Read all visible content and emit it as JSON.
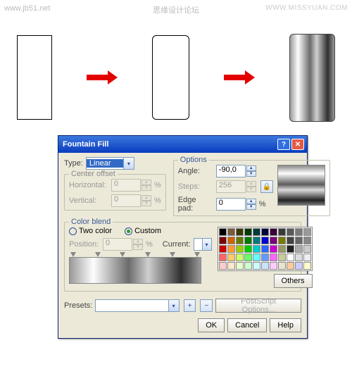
{
  "watermarks": {
    "left": "www.jb51.net",
    "center": "思缘设计论坛",
    "right": "WWW.MISSYUAN.COM"
  },
  "dialog": {
    "title": "Fountain Fill",
    "type_label": "Type:",
    "type_value": "Linear",
    "center_offset": {
      "title": "Center offset",
      "horiz_label": "Horizontal:",
      "horiz_val": "0",
      "horiz_unit": "%",
      "vert_label": "Vertical:",
      "vert_val": "0",
      "vert_unit": "%"
    },
    "options": {
      "title": "Options",
      "angle_label": "Angle:",
      "angle_val": "-90,0",
      "steps_label": "Steps:",
      "steps_val": "256",
      "edge_label": "Edge pad:",
      "edge_val": "0",
      "edge_unit": "%"
    },
    "color_blend": {
      "title": "Color blend",
      "two_color": "Two color",
      "custom": "Custom",
      "position_label": "Position:",
      "position_val": "0",
      "position_unit": "%",
      "current_label": "Current:",
      "others": "Others"
    },
    "presets_label": "Presets:",
    "postscript": "PostScript Options...",
    "ok": "OK",
    "cancel": "Cancel",
    "help": "Help"
  },
  "palette": [
    "#000000",
    "#7a5c3a",
    "#3a3a00",
    "#003a00",
    "#003a3a",
    "#00003a",
    "#3a003a",
    "#3a3a3a",
    "#5a5a5a",
    "#7a7a7a",
    "#9a9a9a",
    "#7a0000",
    "#cc6600",
    "#667a00",
    "#007a00",
    "#007a7a",
    "#0000cc",
    "#7a007a",
    "#7a7a00",
    "#444444",
    "#666666",
    "#888888",
    "#cc0000",
    "#ff9933",
    "#99cc00",
    "#00cc00",
    "#00cccc",
    "#3366ff",
    "#cc00cc",
    "#999966",
    "#222222",
    "#aaaaaa",
    "#cccccc",
    "#ff6666",
    "#ffcc66",
    "#ccff66",
    "#66ff66",
    "#66ffff",
    "#6699ff",
    "#ff66ff",
    "#cccc99",
    "#ffffff",
    "#dddddd",
    "#eeeeee",
    "#ffcccc",
    "#ffe6cc",
    "#e6ffcc",
    "#ccffcc",
    "#ccffff",
    "#cce0ff",
    "#ffccff",
    "#e6e6cc",
    "#ffcc99",
    "#ccccff",
    "#ffffcc"
  ]
}
